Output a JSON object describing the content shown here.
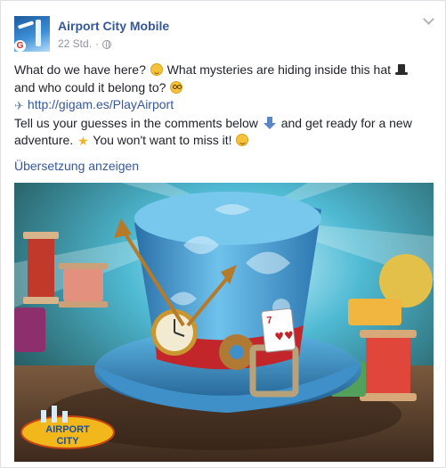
{
  "post": {
    "page_name": "Airport City Mobile",
    "timestamp": "22 Std.",
    "separator": "·",
    "lines": {
      "l1a": "What do we have here?",
      "l1b": "What mysteries are hiding inside this hat",
      "l2a": "and who could it belong to?",
      "link": "http://gigam.es/PlayAirport",
      "l4a": "Tell us your guesses in the comments below",
      "l4b": "and get ready for a new",
      "l5a": "adventure.",
      "l5b": "You won't want to miss it!"
    },
    "translate_label": "Übersetzung anzeigen",
    "image": {
      "logo_line1": "AIRPORT",
      "logo_line2": "CITY",
      "playing_card": "7"
    }
  },
  "colors": {
    "link": "#365899",
    "hat_blue": "#4aa7dd",
    "hat_band": "#c2262b",
    "hat_gold": "#c9962f"
  }
}
